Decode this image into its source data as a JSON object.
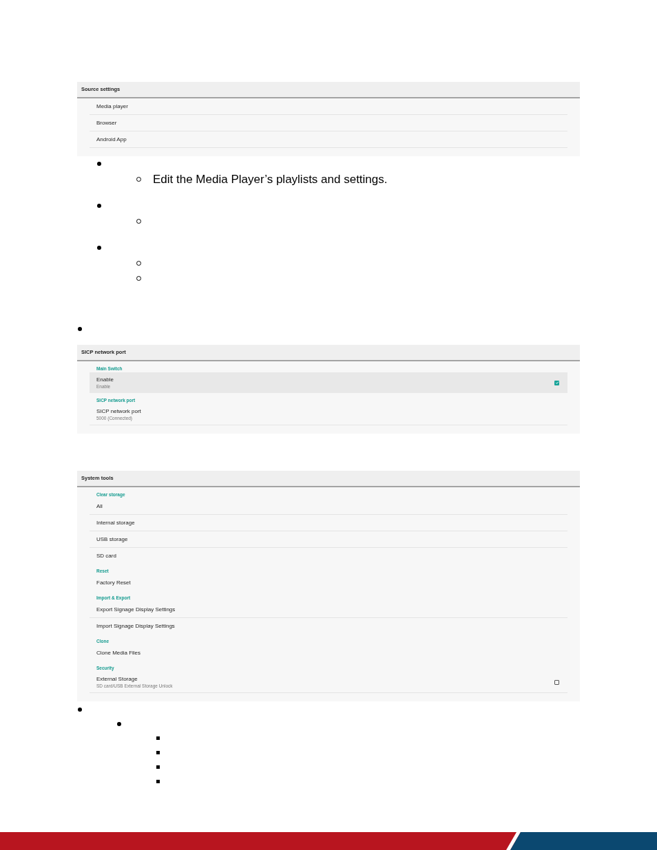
{
  "blocks": [
    {
      "kind": "panel",
      "title": "Source settings",
      "groups": [
        {
          "items": [
            {
              "title": "Media player",
              "selected": false
            },
            {
              "title": "Browser",
              "selected": false
            },
            {
              "title": "Android App",
              "selected": false
            }
          ]
        }
      ]
    },
    {
      "kind": "list",
      "items": [
        {
          "kind": "disc",
          "children": [
            {
              "kind": "circle",
              "text": "Edit the Media Player’s playlists and settings."
            }
          ]
        },
        {
          "kind": "disc",
          "children": [
            {
              "kind": "circle"
            }
          ]
        },
        {
          "kind": "disc",
          "children": [
            {
              "kind": "circle"
            },
            {
              "kind": "circle"
            }
          ]
        }
      ]
    },
    {
      "kind": "list",
      "items": [
        {
          "kind": "disc"
        }
      ]
    },
    {
      "kind": "panel",
      "title": "SICP network port",
      "groups": [
        {
          "label": "Main Switch",
          "items": [
            {
              "title": "Enable",
              "subtitle": "Enable",
              "checked": true,
              "selected": true
            }
          ]
        },
        {
          "label": "SICP network port",
          "items": [
            {
              "title": "SICP network port",
              "subtitle": "5000 (Connected)",
              "selected": false
            }
          ]
        }
      ]
    },
    {
      "kind": "panel",
      "title": "System tools",
      "groups": [
        {
          "label": "Clear storage",
          "items": [
            {
              "title": "All",
              "selected": false
            },
            {
              "title": "Internal storage",
              "selected": false
            },
            {
              "title": "USB storage",
              "selected": false
            },
            {
              "title": "SD card",
              "selected": false
            }
          ]
        },
        {
          "label": "Reset",
          "items": [
            {
              "title": "Factory Reset",
              "selected": false
            }
          ]
        },
        {
          "label": "Import & Export",
          "items": [
            {
              "title": "Export Signage Display Settings",
              "selected": false
            },
            {
              "title": "Import Signage Display Settings",
              "selected": false
            }
          ]
        },
        {
          "label": "Clone",
          "items": [
            {
              "title": "Clone Media Files",
              "selected": false
            }
          ]
        },
        {
          "label": "Security",
          "items": [
            {
              "title": "External Storage",
              "subtitle": "SD card/USB External Storage Unlock",
              "checked": false,
              "selected": false
            }
          ]
        }
      ]
    },
    {
      "kind": "list",
      "items": [
        {
          "kind": "disc",
          "children": [
            {
              "kind": "disc",
              "children": [
                {
                  "kind": "square"
                },
                {
                  "kind": "square"
                },
                {
                  "kind": "square"
                },
                {
                  "kind": "square"
                }
              ]
            }
          ]
        }
      ]
    }
  ]
}
